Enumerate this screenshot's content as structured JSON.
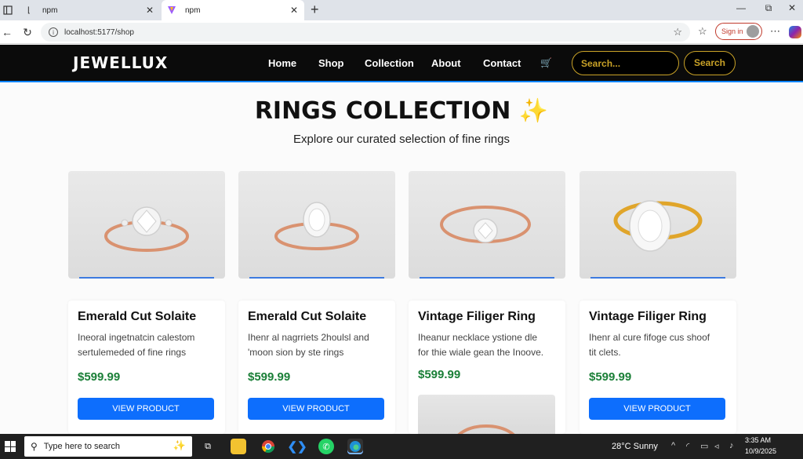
{
  "browser": {
    "tabs": [
      {
        "title": "npm",
        "active": false
      },
      {
        "title": "npm",
        "active": true
      }
    ],
    "new_tab": "+",
    "url": "localhost:5177/shop",
    "sign_in": "Sign in"
  },
  "site": {
    "logo": "JEWELLUX",
    "nav": [
      "Home",
      "Shop",
      "Collection",
      "About",
      "Contact"
    ],
    "search_placeholder": "Search...",
    "search_button": "Search",
    "accent": "#c9a227"
  },
  "page": {
    "title": "RINGS COLLECTION",
    "title_emoji": "✨",
    "subtitle": "Explore our curated selection of fine rings"
  },
  "products": [
    {
      "name": "Emerald Cut Solaite",
      "desc_line1": "Ineoral ingetnatcin calestom",
      "desc_line2": "sertulemeded of fine rings",
      "price": "$599.99",
      "button": "VIEW PRODUCT",
      "metal": "rose"
    },
    {
      "name": "Emerald Cut Solaite",
      "desc_line1": "Ihenr al nagrriets 2houlsl and",
      "desc_line2": "'moon sion by ste rings",
      "price": "$599.99",
      "button": "VIEW PRODUCT",
      "metal": "rose"
    },
    {
      "name": "Vintage Filiger Ring",
      "desc_line1": "Iheanur necklace ystione dle",
      "desc_line2": "for thie wiale gean the Inoove.",
      "price": "$599.99",
      "button": "",
      "metal": "rose"
    },
    {
      "name": "Vintage Filiger Ring",
      "desc_line1": "Ihenr al cure fifoge cus shoof",
      "desc_line2": "tit clets.",
      "price": "$599.99",
      "button": "VIEW PRODUCT",
      "metal": "gold"
    }
  ],
  "taskbar": {
    "search_placeholder": "Type here to search",
    "weather": "28°C  Sunny",
    "time": "3:35 AM",
    "date": "10/9/2025"
  }
}
